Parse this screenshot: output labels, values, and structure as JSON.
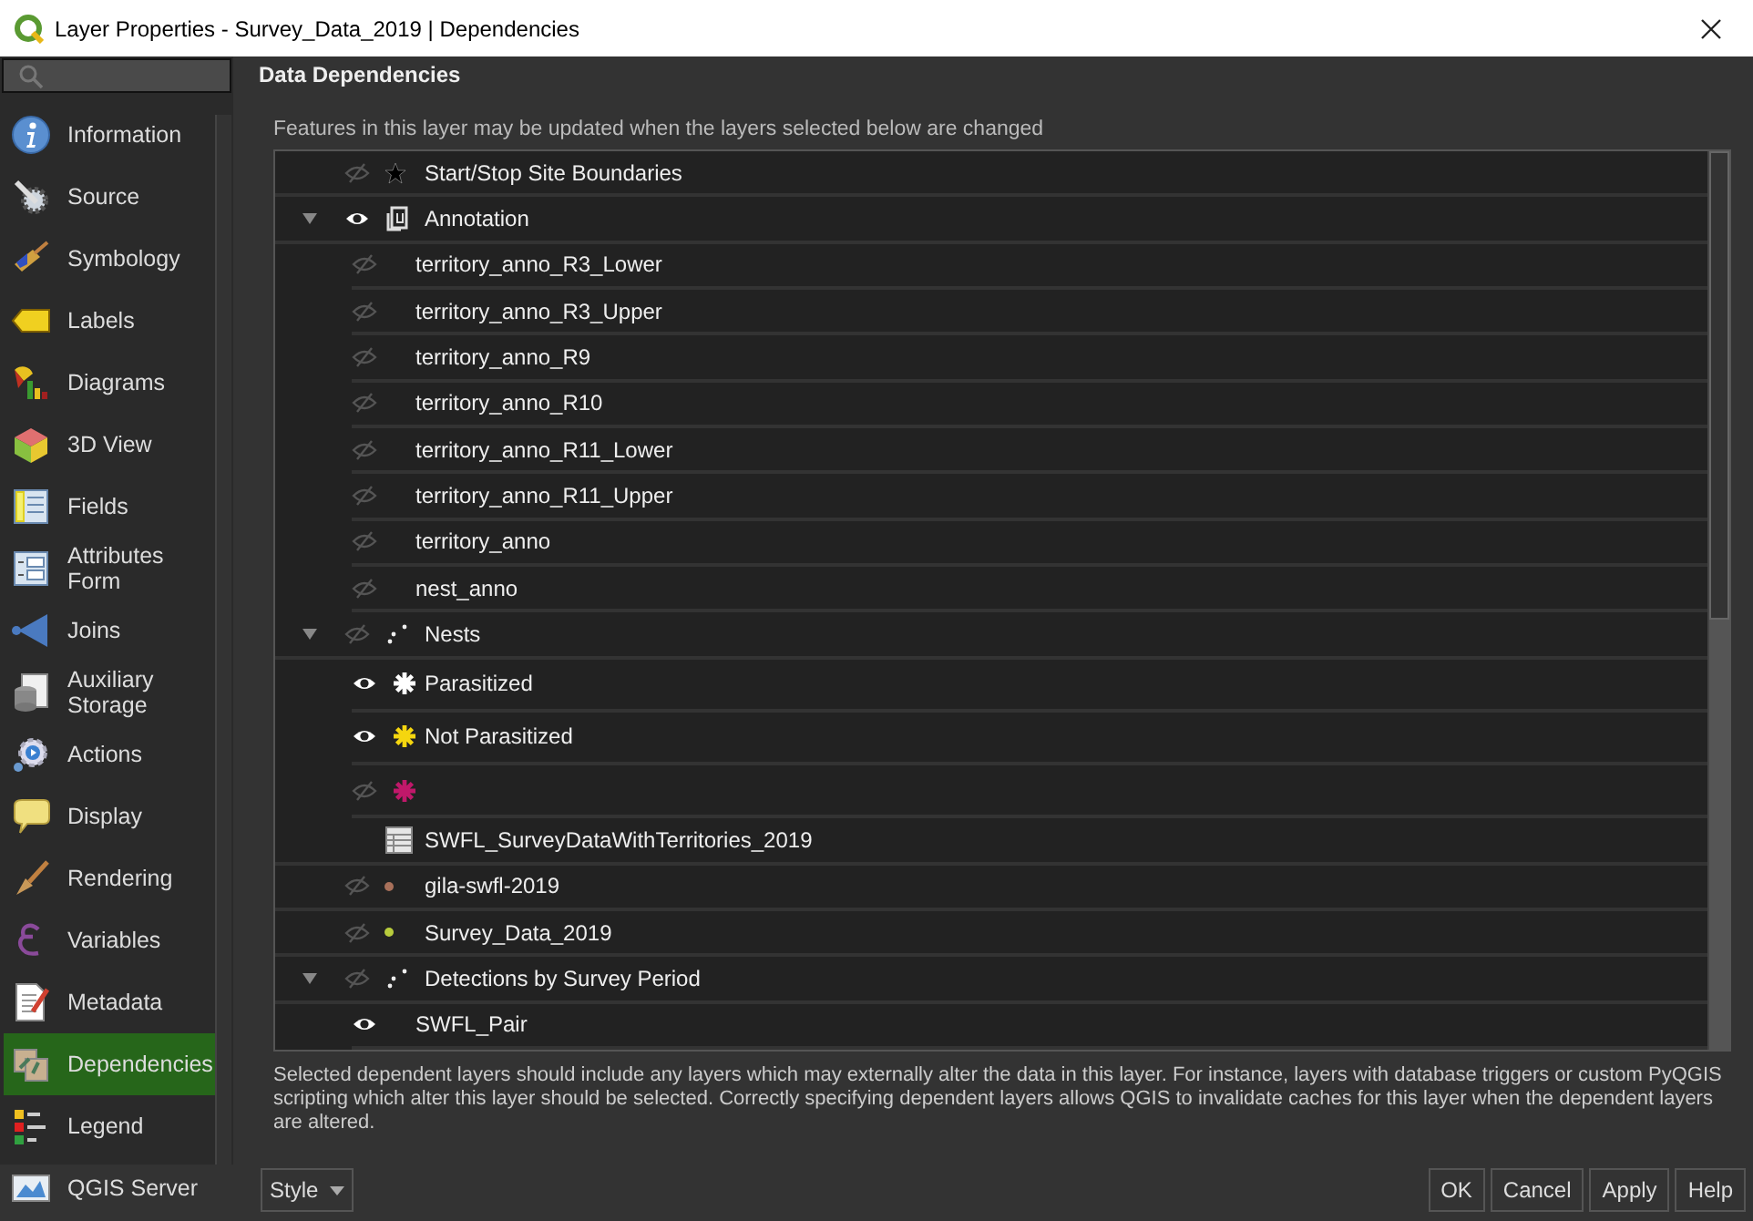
{
  "window": {
    "title": "Layer Properties - Survey_Data_2019 | Dependencies"
  },
  "sidebar": {
    "items": [
      {
        "label": "Information",
        "selected": false
      },
      {
        "label": "Source",
        "selected": false
      },
      {
        "label": "Symbology",
        "selected": false
      },
      {
        "label": "Labels",
        "selected": false
      },
      {
        "label": "Diagrams",
        "selected": false
      },
      {
        "label": "3D View",
        "selected": false
      },
      {
        "label": "Fields",
        "selected": false
      },
      {
        "label": "Attributes Form",
        "selected": false
      },
      {
        "label": "Joins",
        "selected": false
      },
      {
        "label": "Auxiliary Storage",
        "selected": false
      },
      {
        "label": "Actions",
        "selected": false
      },
      {
        "label": "Display",
        "selected": false
      },
      {
        "label": "Rendering",
        "selected": false
      },
      {
        "label": "Variables",
        "selected": false
      },
      {
        "label": "Metadata",
        "selected": false
      },
      {
        "label": "Dependencies",
        "selected": true
      },
      {
        "label": "Legend",
        "selected": false
      },
      {
        "label": "QGIS Server",
        "selected": false
      }
    ]
  },
  "panel": {
    "title": "Data Dependencies",
    "description": "Features in this layer may be updated when the layers selected below are changed",
    "layers": [
      {
        "label": "Start/Stop Site Boundaries",
        "visible": false,
        "kind": "star"
      },
      {
        "label": "Annotation",
        "visible": true,
        "kind": "group",
        "expanded": true,
        "children": [
          {
            "label": "territory_anno_R3_Lower",
            "visible": false,
            "kind": "plain"
          },
          {
            "label": "territory_anno_R3_Upper",
            "visible": false,
            "kind": "plain"
          },
          {
            "label": "territory_anno_R9",
            "visible": false,
            "kind": "plain"
          },
          {
            "label": "territory_anno_R10",
            "visible": false,
            "kind": "plain"
          },
          {
            "label": "territory_anno_R11_Lower",
            "visible": false,
            "kind": "plain"
          },
          {
            "label": "territory_anno_R11_Upper",
            "visible": false,
            "kind": "plain"
          },
          {
            "label": "territory_anno",
            "visible": false,
            "kind": "plain"
          },
          {
            "label": "nest_anno",
            "visible": false,
            "kind": "plain"
          }
        ]
      },
      {
        "label": "Nests",
        "visible": false,
        "kind": "points",
        "expanded": true,
        "children": [
          {
            "label": "Parasitized",
            "visible": true,
            "kind": "asterisk",
            "color": "#ffffff"
          },
          {
            "label": "Not Parasitized",
            "visible": true,
            "kind": "asterisk",
            "color": "#f5d60f"
          },
          {
            "visible": false,
            "kind": "asterisk",
            "color": "#c0186a"
          }
        ]
      },
      {
        "label": "SWFL_SurveyDataWithTerritories_2019",
        "kind": "table"
      },
      {
        "label": "gila-swfl-2019",
        "visible": false,
        "kind": "dot",
        "color": "#a8705a"
      },
      {
        "label": "Survey_Data_2019",
        "visible": false,
        "kind": "dot",
        "color": "#b8cc3c"
      },
      {
        "label": "Detections by Survey Period",
        "visible": false,
        "kind": "points",
        "expanded": true,
        "children": [
          {
            "label": "SWFL_Pair",
            "visible": true,
            "kind": "plain"
          }
        ]
      }
    ],
    "note": "Selected dependent layers should include any layers which may externally alter the data in this layer. For instance, layers with database triggers or custom PyQGIS scripting which alter this layer should be selected. Correctly specifying dependent layers allows QGIS to invalidate caches for this layer when the dependent layers are altered."
  },
  "footer": {
    "style_button": "Style",
    "buttons": [
      "OK",
      "Cancel",
      "Apply",
      "Help"
    ]
  }
}
